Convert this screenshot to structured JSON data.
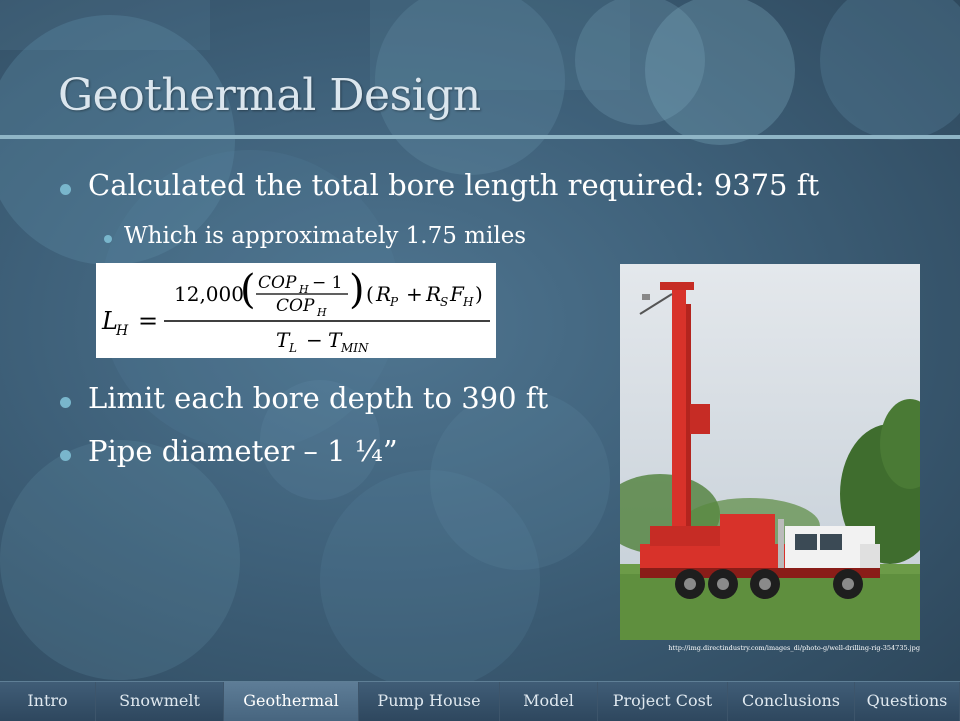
{
  "slide": {
    "title": "Geothermal Design",
    "bullets": [
      "Calculated the total bore length required: 9375 ft",
      "Which is approximately  1.75 miles",
      "Limit each bore depth to 390 ft",
      "Pipe diameter –  1 ¼”"
    ],
    "formula": {
      "lhs": "L",
      "lhs_sub": "H",
      "eq": "=",
      "coef": "12,000",
      "cop": "COP",
      "cop_sub": "H",
      "minus_one": "− 1",
      "rp": "R",
      "rp_sub": "P",
      "plus": "+",
      "rs": "R",
      "rs_sub": "S",
      "fh": "F",
      "fh_sub": "H",
      "tl": "T",
      "tl_sub": "L",
      "minus": "−",
      "tmin": "T",
      "tmin_sub": "MIN"
    },
    "image_caption": "http://img.directindustry.com/images_di/photo-g/well-drilling-rig-354735.jpg"
  },
  "nav": {
    "tabs": [
      "Intro",
      "Snowmelt",
      "Geothermal",
      "Pump House",
      "Model",
      "Project Cost",
      "Conclusions",
      "Questions"
    ],
    "active": "Geothermal"
  },
  "colors": {
    "background": "#3e6079",
    "bullet": "#79b6cc",
    "rule": "#8fb5c6",
    "truck_red": "#d8322a"
  }
}
